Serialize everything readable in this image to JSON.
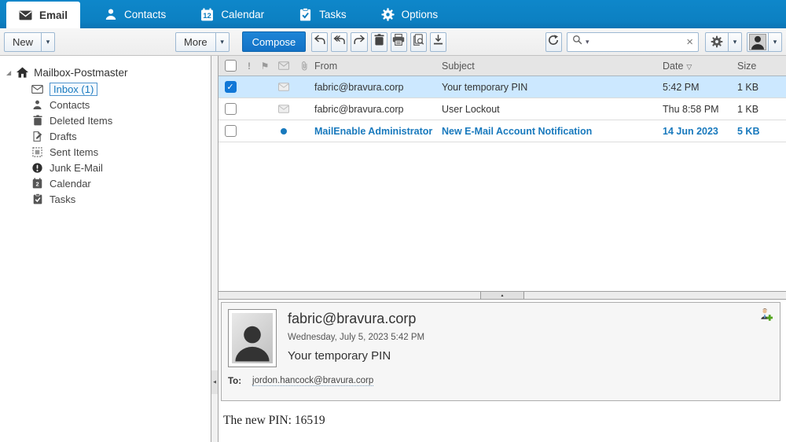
{
  "nav": {
    "tabs": [
      {
        "label": "Email",
        "active": true
      },
      {
        "label": "Contacts",
        "active": false
      },
      {
        "label": "Calendar",
        "active": false
      },
      {
        "label": "Tasks",
        "active": false
      },
      {
        "label": "Options",
        "active": false
      }
    ],
    "calendar_day": "12"
  },
  "toolbar": {
    "new_label": "New",
    "more_label": "More",
    "compose_label": "Compose"
  },
  "search": {
    "value": "",
    "placeholder": ""
  },
  "sidebar": {
    "root": "Mailbox-Postmaster",
    "calendar_day": "2",
    "items": [
      {
        "label": "Inbox (1)",
        "selected": true,
        "unread_count": 1
      },
      {
        "label": "Contacts",
        "selected": false
      },
      {
        "label": "Deleted Items",
        "selected": false
      },
      {
        "label": "Drafts",
        "selected": false
      },
      {
        "label": "Sent Items",
        "selected": false
      },
      {
        "label": "Junk E-Mail",
        "selected": false
      },
      {
        "label": "Calendar",
        "selected": false
      },
      {
        "label": "Tasks",
        "selected": false
      }
    ]
  },
  "list": {
    "columns": {
      "from": "From",
      "subject": "Subject",
      "date": "Date",
      "size": "Size"
    },
    "rows": [
      {
        "from": "fabric@bravura.corp",
        "subject": "Your temporary PIN",
        "date": "5:42 PM",
        "size": "1 KB",
        "checked": true,
        "selected": true,
        "unread": false
      },
      {
        "from": "fabric@bravura.corp",
        "subject": "User Lockout",
        "date": "Thu 8:58 PM",
        "size": "1 KB",
        "checked": false,
        "selected": false,
        "unread": false
      },
      {
        "from": "MailEnable Administrator",
        "subject": "New E-Mail Account Notification",
        "date": "14 Jun 2023",
        "size": "5 KB",
        "checked": false,
        "selected": false,
        "unread": true
      }
    ]
  },
  "preview": {
    "sender": "fabric@bravura.corp",
    "datetime": "Wednesday, July 5, 2023 5:42 PM",
    "subject": "Your temporary PIN",
    "to_label": "To:",
    "to": "jordon.hancock@bravura.corp",
    "body": "The new PIN: 16519"
  },
  "glyphs": {
    "caret": "▾",
    "sort_down": "▽",
    "clear": "×",
    "check": "✓",
    "exclamation": "!",
    "flag": "⚑",
    "expander": "◢",
    "collapse_up": "▲",
    "collapse_left": "◀"
  },
  "colors": {
    "nav_blue": "#0c80c2",
    "accent_blue": "#1478cf",
    "selected_row": "#cce8ff",
    "unread_blue": "#1879bd",
    "checkbox_blue": "#1177d7"
  }
}
